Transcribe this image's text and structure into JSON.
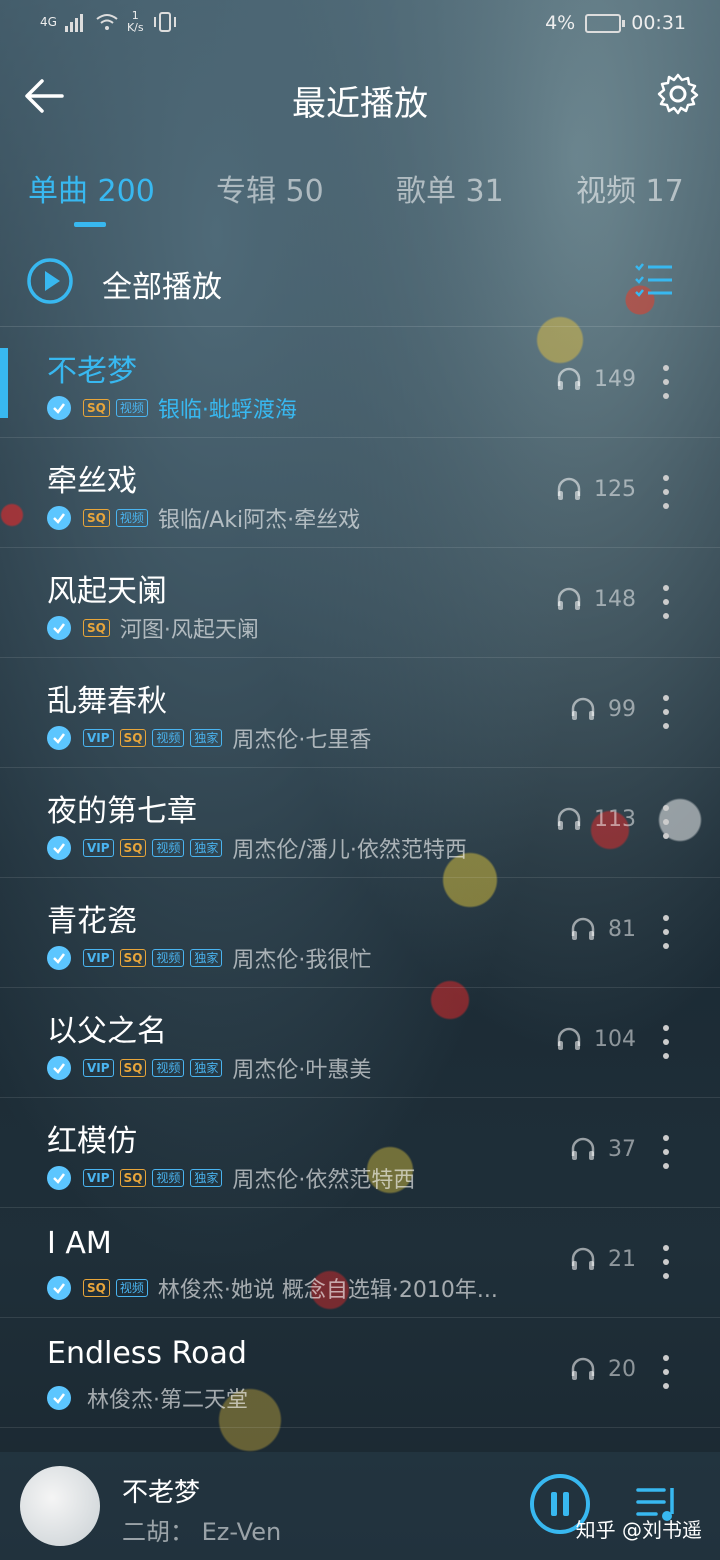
{
  "status": {
    "network": "4G",
    "speed_value": "1",
    "speed_unit": "K/s",
    "battery": "4%",
    "time": "00:31"
  },
  "header": {
    "title": "最近播放"
  },
  "tabs": [
    {
      "label": "单曲 200"
    },
    {
      "label": "专辑 50"
    },
    {
      "label": "歌单 31"
    },
    {
      "label": "视频 17"
    }
  ],
  "play_all": {
    "label": "全部播放"
  },
  "songs": [
    {
      "title": "不老梦",
      "artist": "银临·蚍蜉渡海",
      "plays": "149"
    },
    {
      "title": "牵丝戏",
      "artist": "银临/Aki阿杰·牵丝戏",
      "plays": "125"
    },
    {
      "title": "风起天阑",
      "artist": "河图·风起天阑",
      "plays": "148"
    },
    {
      "title": "乱舞春秋",
      "artist": "周杰伦·七里香",
      "plays": "99"
    },
    {
      "title": "夜的第七章",
      "artist": "周杰伦/潘儿·依然范特西",
      "plays": "113"
    },
    {
      "title": "青花瓷",
      "artist": "周杰伦·我很忙",
      "plays": "81"
    },
    {
      "title": "以父之名",
      "artist": "周杰伦·叶惠美",
      "plays": "104"
    },
    {
      "title": "红模仿",
      "artist": "周杰伦·依然范特西",
      "plays": "37"
    },
    {
      "title": "I AM",
      "artist": "林俊杰·她说 概念自选辑·2010年...",
      "plays": "21"
    },
    {
      "title": "Endless Road",
      "artist": "林俊杰·第二天堂",
      "plays": "20"
    }
  ],
  "tags": {
    "vip": "VIP",
    "sq": "SQ",
    "video": "视频",
    "exclusive": "独家"
  },
  "player": {
    "song": "不老梦",
    "artist": "二胡： Ez-Ven"
  },
  "watermark": "知乎 @刘书遥",
  "colors": {
    "accent": "#38b8f0",
    "sq": "#e8a53a"
  }
}
